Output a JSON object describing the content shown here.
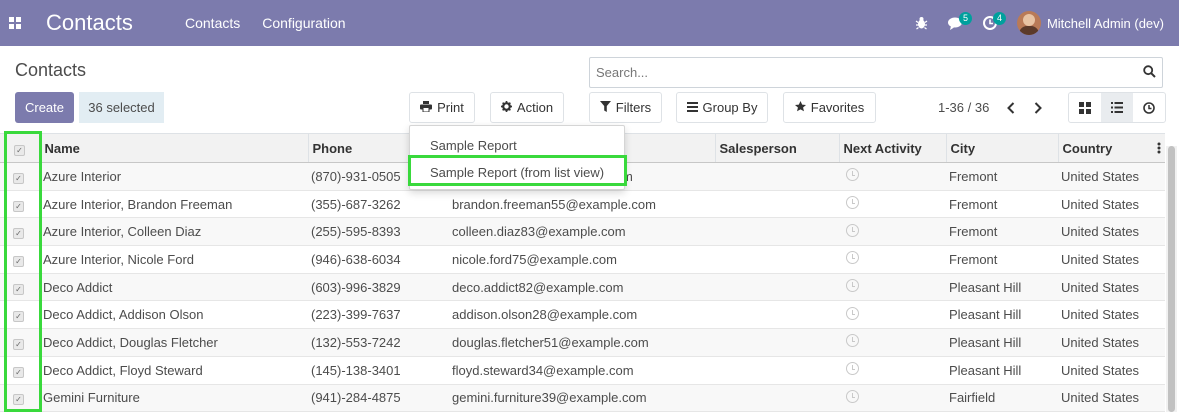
{
  "navbar": {
    "app_title": "Contacts",
    "menu": [
      "Contacts",
      "Configuration"
    ],
    "messages_count": "5",
    "activities_count": "4",
    "user_name": "Mitchell Admin (dev)"
  },
  "control_panel": {
    "breadcrumb": "Contacts",
    "create_label": "Create",
    "selected_label": "36 selected",
    "print_label": "Print",
    "action_label": "Action",
    "search_placeholder": "Search...",
    "filters_label": "Filters",
    "group_by_label": "Group By",
    "favorites_label": "Favorites",
    "pager_text": "1-36 / 36"
  },
  "print_menu": {
    "items": [
      "Sample Report",
      "Sample Report (from list view)"
    ]
  },
  "table": {
    "columns": [
      "Name",
      "Phone",
      "Email",
      "Salesperson",
      "Next Activity",
      "City",
      "Country"
    ],
    "rows": [
      {
        "name": "Azure Interior",
        "phone": "(870)-931-0505",
        "email": "azure.interior24@example.com",
        "salesperson": "",
        "city": "Fremont",
        "country": "United States"
      },
      {
        "name": "Azure Interior, Brandon Freeman",
        "phone": "(355)-687-3262",
        "email": "brandon.freeman55@example.com",
        "salesperson": "",
        "city": "Fremont",
        "country": "United States"
      },
      {
        "name": "Azure Interior, Colleen Diaz",
        "phone": "(255)-595-8393",
        "email": "colleen.diaz83@example.com",
        "salesperson": "",
        "city": "Fremont",
        "country": "United States"
      },
      {
        "name": "Azure Interior, Nicole Ford",
        "phone": "(946)-638-6034",
        "email": "nicole.ford75@example.com",
        "salesperson": "",
        "city": "Fremont",
        "country": "United States"
      },
      {
        "name": "Deco Addict",
        "phone": "(603)-996-3829",
        "email": "deco.addict82@example.com",
        "salesperson": "",
        "city": "Pleasant Hill",
        "country": "United States"
      },
      {
        "name": "Deco Addict, Addison Olson",
        "phone": "(223)-399-7637",
        "email": "addison.olson28@example.com",
        "salesperson": "",
        "city": "Pleasant Hill",
        "country": "United States"
      },
      {
        "name": "Deco Addict, Douglas Fletcher",
        "phone": "(132)-553-7242",
        "email": "douglas.fletcher51@example.com",
        "salesperson": "",
        "city": "Pleasant Hill",
        "country": "United States"
      },
      {
        "name": "Deco Addict, Floyd Steward",
        "phone": "(145)-138-3401",
        "email": "floyd.steward34@example.com",
        "salesperson": "",
        "city": "Pleasant Hill",
        "country": "United States"
      },
      {
        "name": "Gemini Furniture",
        "phone": "(941)-284-4875",
        "email": "gemini.furniture39@example.com",
        "salesperson": "",
        "city": "Fairfield",
        "country": "United States"
      }
    ]
  },
  "colors": {
    "navbar": "#7c7bad",
    "primary_button": "#7c7bad",
    "highlight": "#39d93c",
    "badge": "#00a09d"
  },
  "icons": {
    "apps": "apps-grid-icon",
    "bug": "bug-icon",
    "messages": "chat-icon",
    "activities": "clock-icon",
    "print": "print-icon",
    "action": "gear-icon",
    "search": "search-icon",
    "filters": "filter-icon",
    "group_by": "bars-icon",
    "favorites": "star-icon"
  }
}
